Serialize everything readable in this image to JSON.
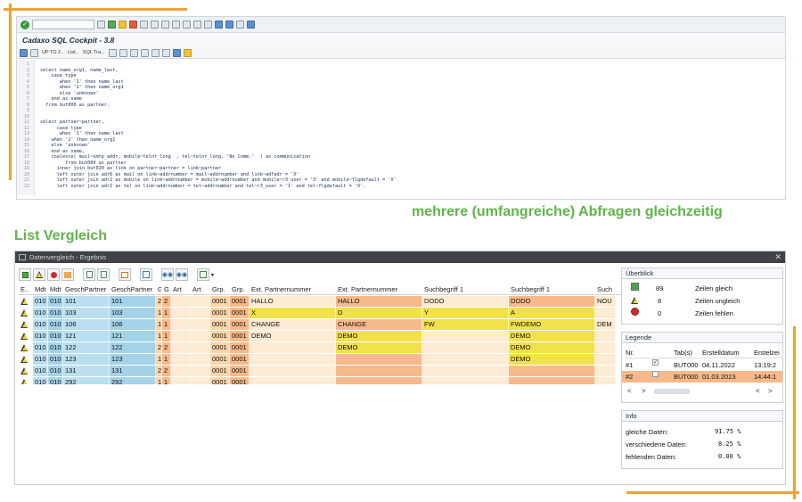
{
  "captions": {
    "multi_query": "mehrere (umfangreiche) Abfragen gleichzeitig",
    "list_compare": "List Vergleich"
  },
  "sql_cockpit": {
    "title": "Cadaxo SQL Cockpit - 3.8",
    "command_field": "",
    "toolbar_labels": [
      "UP TO 2..",
      "List..",
      "SQL Tra..."
    ],
    "code_lines": [
      {
        "n": "1",
        "t": ""
      },
      {
        "n": "2",
        "t": "select name_org1, name_last,"
      },
      {
        "n": "3",
        "t": "    case type"
      },
      {
        "n": "4",
        "t": "       when '1' then name_last"
      },
      {
        "n": "5",
        "t": "       when '2' then name_org1"
      },
      {
        "n": "6",
        "t": "       else 'unknown'"
      },
      {
        "n": "7",
        "t": "    end as name"
      },
      {
        "n": "8",
        "t": "  from but000 as partner."
      },
      {
        "n": "9",
        "t": ""
      },
      {
        "n": "10",
        "t": ""
      },
      {
        "n": "11",
        "t": "select partner~partner,"
      },
      {
        "n": "12",
        "t": "      case type"
      },
      {
        "n": "13",
        "t": "       when '1' then name_last"
      },
      {
        "n": "14",
        "t": "    when '2' then name_org1"
      },
      {
        "n": "15",
        "t": "    else 'unknown'"
      },
      {
        "n": "16",
        "t": "    end as name,"
      },
      {
        "n": "17",
        "t": "    coalesce( mail~smtp_addr, mobile~telnr_long  , tel~telnr_long, 'No Comm.'  ) as communication"
      },
      {
        "n": "18",
        "t": "         from but000 as partner"
      },
      {
        "n": "19",
        "t": "      inner join but020 as link on partner~partner = link~partner"
      },
      {
        "n": "20",
        "t": "      left outer join adr6 as mail on link~addrnumber = mail~addrnumber and link~adfadr = 'X'"
      },
      {
        "n": "21",
        "t": "      left outer join adr2 as mobile on link~addrnumber = mobile~addrnumber and mobile~r3_user = '3' and mobile~flgdefault = 'X'"
      },
      {
        "n": "22",
        "t": "      left outer join adr2 as tel on link~addrnumber = tel~addrnumber and tel~r3_user = '1' and tel~flgdefault = 'X'."
      }
    ]
  },
  "list_window": {
    "title": "Datenvergleich - Ergebnis",
    "close": "✕",
    "columns": [
      "E..",
      "Mdt",
      "Mdt",
      "GeschPartner",
      "GeschPartner",
      "G",
      "G",
      "Art",
      "Art",
      "Grp.",
      "Grp.",
      "Ext. Partnernummer",
      "Ext. Partnernummer",
      "Suchbegriff 1",
      "Suchbegriff 1",
      "Such"
    ],
    "rows": [
      [
        "",
        "010",
        "010",
        "101",
        "101",
        "2",
        "2",
        "",
        "",
        "0001",
        "0001",
        "HALLO",
        "HALLO",
        "DODO",
        "DODO",
        "NOU"
      ],
      [
        "",
        "010",
        "010",
        "103",
        "103",
        "1",
        "1",
        "",
        "",
        "0001",
        "0001",
        "X",
        "D",
        "Y",
        "A",
        ""
      ],
      [
        "",
        "010",
        "010",
        "106",
        "106",
        "1",
        "1",
        "",
        "",
        "0001",
        "0001",
        "CHANGE",
        "CHANGE",
        "FW",
        "FWDEMO",
        "DEM"
      ],
      [
        "",
        "010",
        "010",
        "121",
        "121",
        "1",
        "1",
        "",
        "",
        "0001",
        "0001",
        "DEMO",
        "DEMO",
        "",
        "DEMO",
        ""
      ],
      [
        "",
        "010",
        "010",
        "122",
        "122",
        "2",
        "2",
        "",
        "",
        "0001",
        "0001",
        "",
        "DEMO",
        "",
        "DEMO",
        ""
      ],
      [
        "",
        "010",
        "010",
        "123",
        "123",
        "1",
        "1",
        "",
        "",
        "0001",
        "0001",
        "",
        "",
        "",
        "DEMO",
        ""
      ],
      [
        "",
        "010",
        "010",
        "131",
        "131",
        "2",
        "2",
        "",
        "",
        "0001",
        "0001",
        "",
        "",
        "",
        "",
        ""
      ],
      [
        "",
        "010",
        "010",
        "292",
        "292",
        "1",
        "1",
        "",
        "",
        "0001",
        "0001",
        "",
        "",
        "",
        "",
        ""
      ]
    ],
    "cell_colors": {
      "key": "#b9dff0",
      "key_dark": "#a4d3e9",
      "orange_a": "#fcd5aa",
      "orange_b": "#f7b98a",
      "yellow": "#f1e14a",
      "pale": "#fdebd3"
    }
  },
  "ueberblick": {
    "title": "Überblick",
    "rows": [
      {
        "count": "89",
        "label": "Zeilen gleich",
        "icon": "green-square-icon"
      },
      {
        "count": "8",
        "label": "Zeilen ungleich",
        "icon": "warning-triangle-icon"
      },
      {
        "count": "0",
        "label": "Zeilen fehlen",
        "icon": "red-circle-icon"
      }
    ]
  },
  "legende": {
    "title": "Legende",
    "columns": [
      "Nr.",
      "",
      "Tab(s)",
      "Erstelldatum",
      "Erstelzei"
    ],
    "rows": [
      {
        "nr": "#1",
        "checked": "✓",
        "tab": "BUT000",
        "date": "04.11.2022",
        "time": "13:19:2"
      },
      {
        "nr": "#2",
        "checked": "",
        "tab": "BUT000",
        "date": "01.03.2023",
        "time": "14:44:1"
      }
    ],
    "scroll_left": "<",
    "scroll_right": ">"
  },
  "info": {
    "title": "Info",
    "rows": [
      {
        "label": "gleiche Daten:",
        "value": "91.75 %"
      },
      {
        "label": "verschiedene Daten:",
        "value": "8.25 %"
      },
      {
        "label": "fehlenden Daten:",
        "value": "0.00 %"
      }
    ]
  }
}
